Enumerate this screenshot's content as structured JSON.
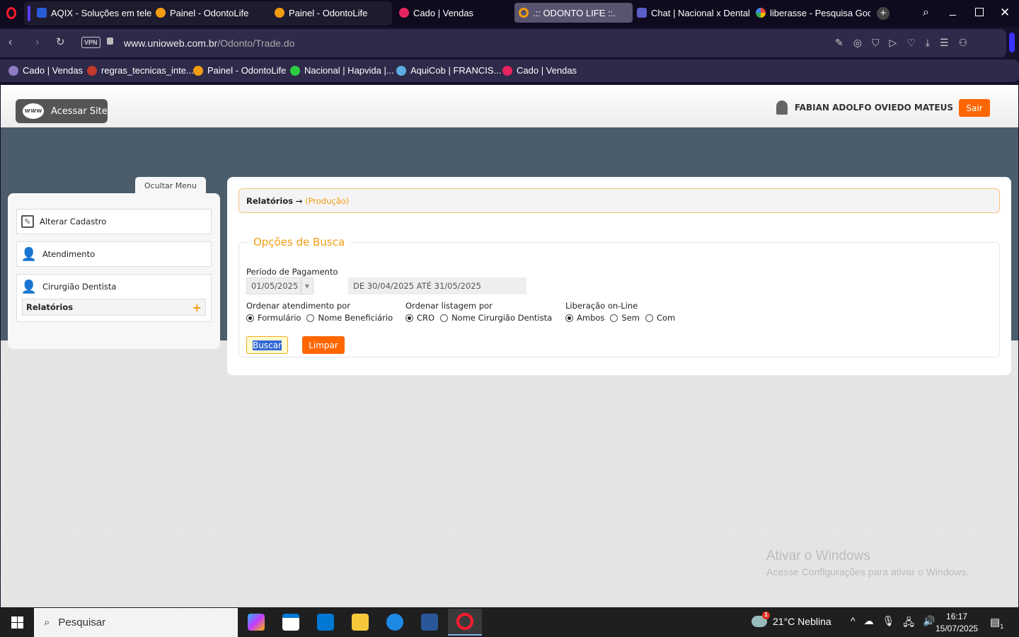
{
  "browser": {
    "tabs": [
      {
        "title": "AQIX - Soluções em telefo",
        "color": "#2a5bd7"
      },
      {
        "title": "Painel - OdontoLife",
        "color": "#f39c12"
      },
      {
        "title": "Painel - OdontoLife",
        "color": "#f39c12"
      },
      {
        "title": "Cado | Vendas",
        "color": "#e5245e"
      },
      {
        "title": ".:: ODONTO LIFE ::.",
        "color": "#f39c12",
        "active": true
      },
      {
        "title": "Chat | Nacional x Dental | I",
        "color": "#5b5fc7"
      },
      {
        "title": "liberasse - Pesquisa Googl",
        "color": "#4285f4"
      }
    ],
    "url_host": "www.unioweb.com.br",
    "url_path": "/Odonto/Trade.do",
    "vpn_label": "VPN",
    "bookmarks": [
      {
        "title": "Cado | Vendas",
        "color": "#8e7cc3"
      },
      {
        "title": "regras_tecnicas_inte...",
        "color": "#c0392b"
      },
      {
        "title": "Painel - OdontoLife",
        "color": "#f39c12"
      },
      {
        "title": "Nacional | Hapvida |...",
        "color": "#2ecc40"
      },
      {
        "title": "AquiCob | FRANCIS...",
        "color": "#5dade2"
      },
      {
        "title": "Cado | Vendas",
        "color": "#e5245e"
      }
    ]
  },
  "header": {
    "site_button": "Acessar Site",
    "www": "www",
    "user_name": "FABIAN ADOLFO OVIEDO MATEUS",
    "logout": "Sair"
  },
  "menu": {
    "toggle": "Ocultar Menu",
    "items": [
      "Alterar Cadastro",
      "Atendimento",
      "Cirurgião Dentista"
    ],
    "submenu": "Relatórios",
    "submenu_icon": "+"
  },
  "content": {
    "breadcrumb": {
      "section": "Relatórios",
      "arrow": "→",
      "page": "(Produção)"
    },
    "legend": "Opções de Busca",
    "period_label": "Período de Pagamento",
    "period_value": "01/05/2025",
    "period_range": "DE 30/04/2025 ATÉ 31/05/2025",
    "order_att": {
      "label": "Ordenar atendimento por",
      "options": [
        "Formulário",
        "Nome Beneficiário"
      ],
      "selected": 0
    },
    "order_list": {
      "label": "Ordenar listagem por",
      "options": [
        "CRO",
        "Nome Cirurgião Dentista"
      ],
      "selected": 0
    },
    "release": {
      "label": "Liberação on-Line",
      "options": [
        "Ambos",
        "Sem",
        "Com"
      ],
      "selected": 0
    },
    "search_btn": "Buscar",
    "clear_btn": "Limpar"
  },
  "watermark": {
    "title": "Ativar o Windows",
    "subtitle": "Acesse Configurações para ativar o Windows."
  },
  "taskbar": {
    "search": "Pesquisar",
    "weather": "21°C  Neblina",
    "weather_badge": "1",
    "time": "16:17",
    "date": "15/07/2025",
    "notif_count": "1"
  },
  "colors": {
    "accent": "#ff6600",
    "legend": "#f39c12",
    "slate": "#4b5d6b"
  }
}
